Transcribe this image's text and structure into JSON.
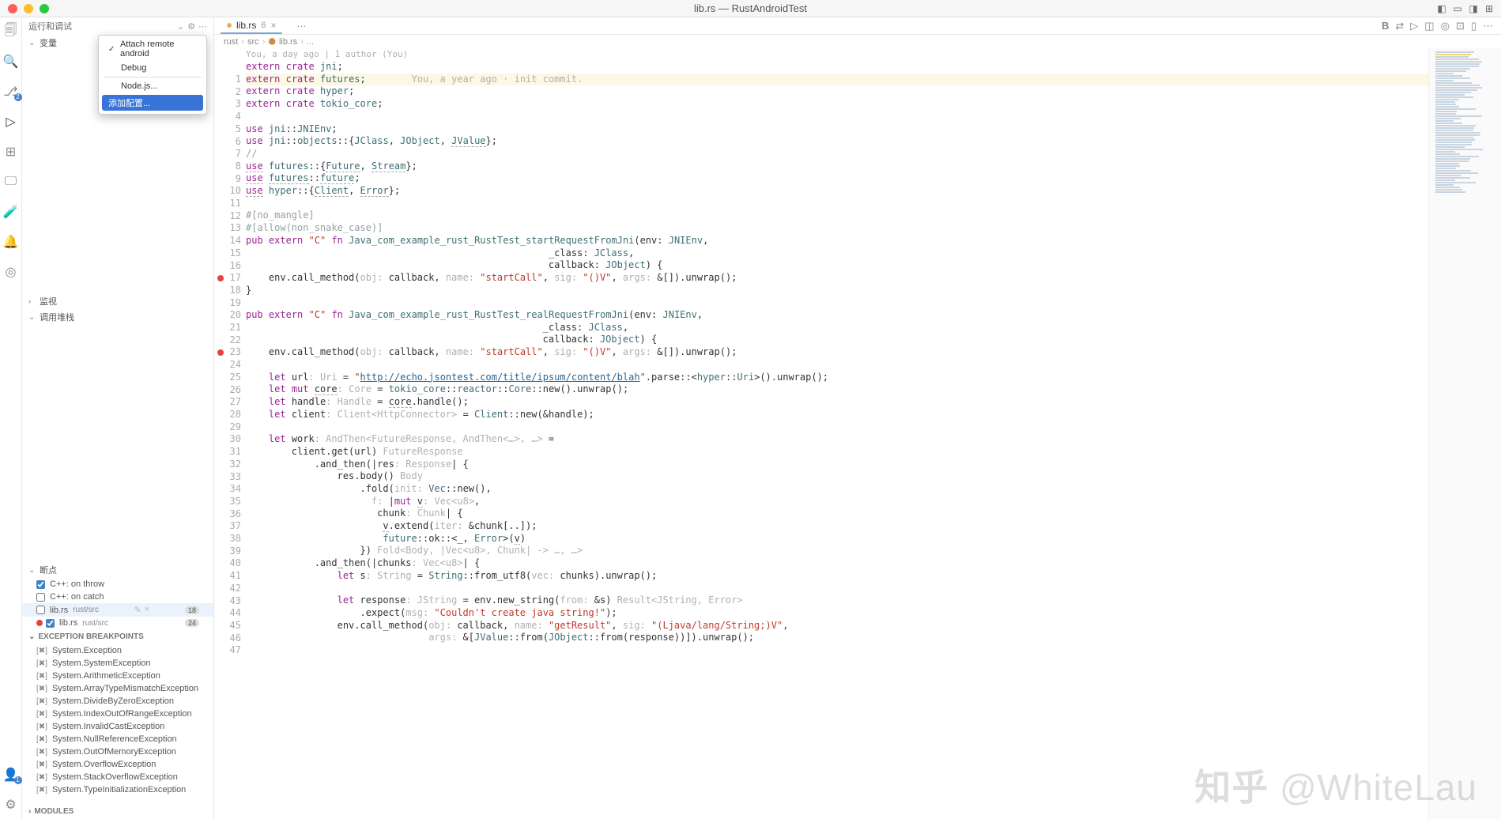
{
  "window": {
    "title": "lib.rs — RustAndroidTest"
  },
  "activity_bar": {
    "branch_badge": "2",
    "profile_badge": "1"
  },
  "config_menu": {
    "items": [
      {
        "label": "Attach remote android",
        "checked": true
      },
      {
        "label": "Debug",
        "checked": false
      }
    ],
    "node": "Node.js...",
    "add": "添加配置..."
  },
  "sidebar": {
    "header": "运行和调试",
    "variables": "变量",
    "watch": "监视",
    "callstack": "调用堆栈",
    "breakpoints_hdr": "断点",
    "breakpoints": [
      {
        "label": "C++: on throw",
        "checked": true
      },
      {
        "label": "C++: on catch",
        "checked": false
      }
    ],
    "bp_files": [
      {
        "file": "lib.rs",
        "path": "rust/src",
        "count": "18",
        "checked": false,
        "hl": true
      },
      {
        "file": "lib.rs",
        "path": "rust/src",
        "count": "24",
        "checked": true,
        "hl": false,
        "dot": true
      }
    ],
    "exc_hdr": "EXCEPTION BREAKPOINTS",
    "exceptions": [
      "System.Exception",
      "System.SystemException",
      "System.ArithmeticException",
      "System.ArrayTypeMismatchException",
      "System.DivideByZeroException",
      "System.IndexOutOfRangeException",
      "System.InvalidCastException",
      "System.NullReferenceException",
      "System.OutOfMemoryException",
      "System.OverflowException",
      "System.StackOverflowException",
      "System.TypeInitializationException"
    ],
    "modules_hdr": "MODULES"
  },
  "tabs": {
    "file_icon": "⬢",
    "filename": "lib.rs",
    "modified": "6"
  },
  "breadcrumb": [
    "rust",
    "src",
    "lib.rs",
    "..."
  ],
  "lens": "You, a day ago | 1 author (You)",
  "inline_blame": "You, a year ago · init commit.",
  "code": {
    "lines": [
      {
        "n": 1,
        "html": "<span class='kw'>extern</span> <span class='kw'>crate</span> <span class='ty'>jni</span>;"
      },
      {
        "n": 2,
        "html": "<span class='kw'>extern</span> <span class='kw'>crate</span> <span class='ty'>futures</span>;        <span class='cm2'>You, a year ago · init commit.</span>",
        "hl": true
      },
      {
        "n": 3,
        "html": "<span class='kw'>extern</span> <span class='kw'>crate</span> <span class='ty'>hyper</span>;"
      },
      {
        "n": 4,
        "html": "<span class='kw'>extern</span> <span class='kw'>crate</span> <span class='ty'>tokio_core</span>;"
      },
      {
        "n": 5,
        "html": ""
      },
      {
        "n": 6,
        "html": "<span class='kw'>use</span> <span class='ty'>jni</span>::<span class='ty'>JNIEnv</span>;"
      },
      {
        "n": 7,
        "html": "<span class='kw'>use</span> <span class='ty'>jni</span>::<span class='ty'>objects</span>::{<span class='ty'>JClass</span>, <span class='ty'>JObject</span>, <span class='ty und-w'>JValue</span>};"
      },
      {
        "n": 8,
        "html": "<span class='cm'>//</span>"
      },
      {
        "n": 9,
        "html": "<span class='kw und-w'>use</span> <span class='ty'>futures</span>::{<span class='ty und-w'>Future</span>, <span class='ty und-w'>Stream</span>};"
      },
      {
        "n": 10,
        "html": "<span class='kw und-w'>use</span> <span class='ty und-w'>futures</span>::<span class='ty und-w'>future</span>;"
      },
      {
        "n": 11,
        "html": "<span class='kw und-w'>use</span> <span class='ty'>hyper</span>::{<span class='ty und-w'>Client</span>, <span class='ty und-w'>Error</span>};"
      },
      {
        "n": 12,
        "html": ""
      },
      {
        "n": 13,
        "html": "<span class='attr'>#[no_mangle]</span>"
      },
      {
        "n": 14,
        "html": "<span class='attr'>#[allow(non_snake_case)]</span>"
      },
      {
        "n": 15,
        "html": "<span class='kw'>pub</span> <span class='kw'>extern</span> <span class='str'>\"C\"</span> <span class='kw'>fn</span> <span class='fn'>Java_com_example_rust_RustTest_startRequestFromJni</span>(env: <span class='ty'>JNIEnv</span>,"
      },
      {
        "n": 16,
        "html": "                                                     _class: <span class='ty'>JClass</span>,"
      },
      {
        "n": 17,
        "html": "                                                     callback: <span class='ty'>JObject</span>) {"
      },
      {
        "n": 18,
        "html": "    env.call_method(<span class='hint'>obj:</span> callback, <span class='hint'>name:</span> <span class='str'>\"startCall\"</span>, <span class='hint'>sig:</span> <span class='str'>\"()V\"</span>, <span class='hint'>args:</span> &[]).unwrap();",
        "bp": true
      },
      {
        "n": 19,
        "html": "}"
      },
      {
        "n": 20,
        "html": ""
      },
      {
        "n": 21,
        "html": "<span class='kw'>pub</span> <span class='kw'>extern</span> <span class='str'>\"C\"</span> <span class='kw'>fn</span> <span class='fn'>Java_com_example_rust_RustTest_realRequestFromJni</span>(env: <span class='ty'>JNIEnv</span>,"
      },
      {
        "n": 22,
        "html": "                                                    _class: <span class='ty'>JClass</span>,"
      },
      {
        "n": 23,
        "html": "                                                    callback: <span class='ty'>JObject</span>) {"
      },
      {
        "n": 24,
        "html": "    env.call_method(<span class='hint'>obj:</span> callback, <span class='hint'>name:</span> <span class='str'>\"startCall\"</span>, <span class='hint'>sig:</span> <span class='str'>\"()V\"</span>, <span class='hint'>args:</span> &[]).unwrap();",
        "bp": true
      },
      {
        "n": 25,
        "html": ""
      },
      {
        "n": 26,
        "html": "    <span class='kw'>let</span> url<span class='hint'>: Uri</span> = <span class='str'>\"<span class='link'>http://echo.jsontest.com/title/ipsum/content/blah</span>\"</span>.parse::&lt;<span class='ty'>hyper</span>::<span class='ty'>Uri</span>&gt;().unwrap();"
      },
      {
        "n": 27,
        "html": "    <span class='kw'>let</span> <span class='kw'>mut</span> <span class='und-w'>core</span><span class='hint'>: Core</span> = <span class='ty'>tokio_core</span>::<span class='ty'>reactor</span>::<span class='ty'>Core</span>::new().unwrap();"
      },
      {
        "n": 28,
        "html": "    <span class='kw'>let</span> handle<span class='hint'>: Handle</span> = <span class='und-w'>core</span>.handle();"
      },
      {
        "n": 29,
        "html": "    <span class='kw'>let</span> client<span class='hint'>: Client&lt;HttpConnector&gt;</span> = <span class='ty'>Client</span>::new(&handle);"
      },
      {
        "n": 30,
        "html": ""
      },
      {
        "n": 31,
        "html": "    <span class='kw'>let</span> work<span class='hint'>: AndThen&lt;FutureResponse, AndThen&lt;…&gt;, …&gt;</span> ="
      },
      {
        "n": 32,
        "html": "        client.get(url) <span class='hint'>FutureResponse</span>"
      },
      {
        "n": 33,
        "html": "            .and_then(|res<span class='hint'>: Response</span>| {"
      },
      {
        "n": 34,
        "html": "                res.body() <span class='hint'>Body</span>"
      },
      {
        "n": 35,
        "html": "                    .fold(<span class='hint'>init:</span> <span class='ty'>Vec</span>::new(),"
      },
      {
        "n": 36,
        "html": "                      <span class='hint'>f:</span> |<span class='kw'>mut</span> <span class='und-w'>v</span><span class='hint'>: Vec&lt;u8&gt;</span>,"
      },
      {
        "n": 37,
        "html": "                       chunk<span class='hint'>: Chunk</span>| {"
      },
      {
        "n": 38,
        "html": "                        <span class='und-w'>v</span>.extend(<span class='hint'>iter:</span> &chunk[..]);"
      },
      {
        "n": 39,
        "html": "                        <span class='ty'>future</span>::ok::&lt;_, <span class='ty'>Error</span>&gt;(<span class='und-w'>v</span>)"
      },
      {
        "n": 40,
        "html": "                    }) <span class='hint'>Fold&lt;Body, |Vec&lt;u8&gt;, Chunk| -&gt; …, …&gt;</span>"
      },
      {
        "n": 41,
        "html": "            .and_then(|chunks<span class='hint'>: Vec&lt;u8&gt;</span>| {"
      },
      {
        "n": 42,
        "html": "                <span class='kw'>let</span> s<span class='hint'>: String</span> = <span class='ty'>String</span>::from_utf8(<span class='hint'>vec:</span> chunks).unwrap();"
      },
      {
        "n": 43,
        "html": ""
      },
      {
        "n": 44,
        "html": "                <span class='kw'>let</span> response<span class='hint'>: JString</span> = env.new_string(<span class='hint'>from:</span> &s) <span class='hint'>Result&lt;JString, Error&gt;</span>"
      },
      {
        "n": 45,
        "html": "                    .expect(<span class='hint'>msg:</span> <span class='str'>\"Couldn't create java string!\"</span>);"
      },
      {
        "n": 46,
        "html": "                env.call_method(<span class='hint'>obj:</span> callback, <span class='hint'>name:</span> <span class='str'>\"getResult\"</span>, <span class='hint'>sig:</span> <span class='str'>\"(Ljava/lang/String;)V\"</span>,"
      },
      {
        "n": 47,
        "html": "                                <span class='hint'>args:</span> &[<span class='ty'>JValue</span>::from(<span class='ty'>JObject</span>::from(response))]).unwrap();"
      }
    ]
  },
  "watermark": {
    "zh": "知乎",
    "at": "@WhiteLau"
  }
}
